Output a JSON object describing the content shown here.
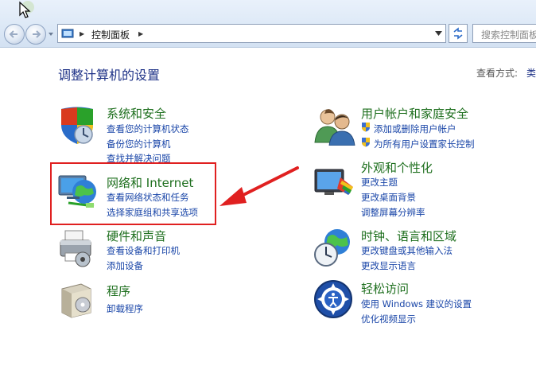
{
  "toolbar": {
    "address": "控制面板",
    "search_placeholder": "搜索控制面板"
  },
  "main": {
    "title": "调整计算机的设置",
    "view_label": "查看方式:",
    "view_value": "类"
  },
  "categories": {
    "system": {
      "title": "系统和安全",
      "links": [
        "查看您的计算机状态",
        "备份您的计算机",
        "查找并解决问题"
      ]
    },
    "network": {
      "title": "网络和 Internet",
      "links": [
        "查看网络状态和任务",
        "选择家庭组和共享选项"
      ]
    },
    "hardware": {
      "title": "硬件和声音",
      "links": [
        "查看设备和打印机",
        "添加设备"
      ]
    },
    "programs": {
      "title": "程序",
      "links": [
        "卸载程序"
      ]
    },
    "users": {
      "title": "用户帐户和家庭安全",
      "links": [
        "添加或删除用户帐户",
        "为所有用户设置家长控制"
      ]
    },
    "appearance": {
      "title": "外观和个性化",
      "links": [
        "更改主题",
        "更改桌面背景",
        "调整屏幕分辨率"
      ]
    },
    "clock": {
      "title": "时钟、语言和区域",
      "links": [
        "更改键盘或其他输入法",
        "更改显示语言"
      ]
    },
    "ease": {
      "title": "轻松访问",
      "links": [
        "使用 Windows 建议的设置",
        "优化视频显示"
      ]
    }
  },
  "colors": {
    "category_title": "#1e6f1e",
    "link": "#1a46a8",
    "page_title": "#1e3287",
    "highlight": "#e02020"
  }
}
